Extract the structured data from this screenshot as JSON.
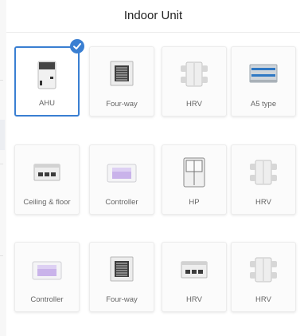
{
  "header": {
    "title": "Indoor Unit"
  },
  "units": [
    {
      "label": "AHU",
      "icon": "ahu-icon",
      "selected": true
    },
    {
      "label": "Four-way",
      "icon": "four-way-cassette-icon",
      "selected": false
    },
    {
      "label": "HRV",
      "icon": "hrv-icon",
      "selected": false
    },
    {
      "label": "A5 type",
      "icon": "a5-type-icon",
      "selected": false
    },
    {
      "label": "Ceiling & floor",
      "icon": "ceiling-floor-icon",
      "selected": false
    },
    {
      "label": "Controller",
      "icon": "controller-icon",
      "selected": false
    },
    {
      "label": "HP",
      "icon": "hp-icon",
      "selected": false
    },
    {
      "label": "HRV",
      "icon": "hrv-icon",
      "selected": false
    },
    {
      "label": "Controller",
      "icon": "controller-icon",
      "selected": false
    },
    {
      "label": "Four-way",
      "icon": "four-way-cassette-icon",
      "selected": false
    },
    {
      "label": "HRV",
      "icon": "ceiling-floor-icon",
      "selected": false
    },
    {
      "label": "HRV",
      "icon": "hrv-icon",
      "selected": false
    }
  ],
  "colors": {
    "accent": "#3a7fd2"
  }
}
